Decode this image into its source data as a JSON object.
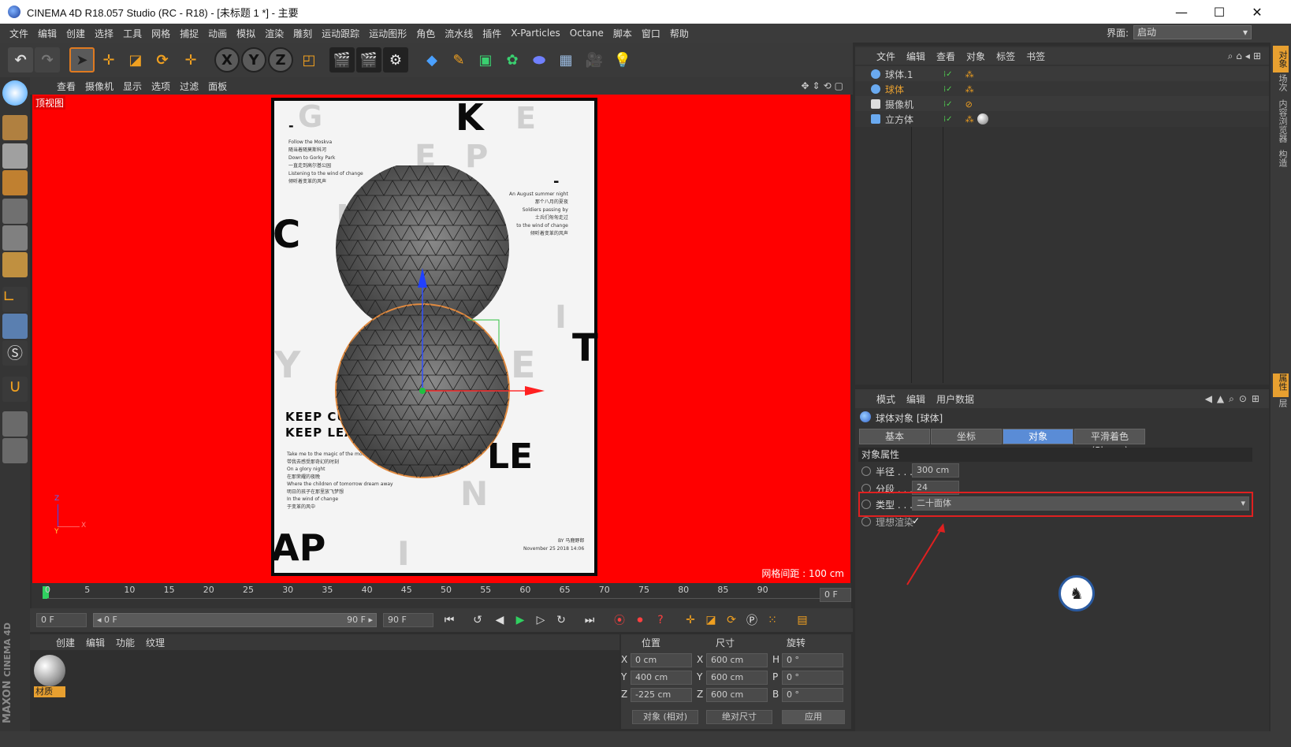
{
  "window": {
    "title": "CINEMA 4D R18.057 Studio (RC - R18) - [未标题 1 *] - 主要",
    "min": "—",
    "max": "☐",
    "close": "✕"
  },
  "menu": [
    "文件",
    "编辑",
    "创建",
    "选择",
    "工具",
    "网格",
    "捕捉",
    "动画",
    "模拟",
    "渲染",
    "雕刻",
    "运动跟踪",
    "运动图形",
    "角色",
    "流水线",
    "插件",
    "X-Particles",
    "Octane",
    "脚本",
    "窗口",
    "帮助"
  ],
  "layout": {
    "label": "界面:",
    "value": "启动"
  },
  "toolbar": {
    "x": "X",
    "y": "Y",
    "z": "Z"
  },
  "viewport": {
    "menu": [
      "查看",
      "摄像机",
      "显示",
      "选项",
      "过滤",
      "面板"
    ],
    "view_name": "顶视图",
    "grid_spacing": "网格间距 : 100 cm",
    "axis_y": "Y",
    "axis_z": "Z",
    "axis_x": "X"
  },
  "poster": {
    "big": {
      "g1": "G",
      "k": "K",
      "e1": "E",
      "e2": "E",
      "p": "P",
      "c": "C",
      "u": "U",
      "i1": "I",
      "t": "T",
      "y": "Y",
      "e3": "E",
      "le": "LE",
      "n": "N",
      "ap": "AP",
      "i2": "I",
      "dash1": "-",
      "dash2": "-"
    },
    "left_text": [
      "Follow the Moskva",
      "随当着随莫斯科河",
      "Down to Gorky Park",
      "一直走到高尔基公园",
      "Listening to the wind of change",
      "倾听着变革的风声"
    ],
    "right_text": [
      "An August summer night",
      "那个八月的夏夜",
      "Soldiers passing by",
      "士兵们匆匆走过",
      "to the wind of change",
      "倾听着变革的风声"
    ],
    "headline1": "KEEP CUR",
    "headline2": "KEEP LEAR",
    "lower_text": [
      "Take me to the magic of the moment",
      "带我去感受那奇幻的时刻",
      "On a glory night",
      "在那荣耀的夜晚",
      "Where the children of tomorrow dream away",
      "明日的孩子在那里放飞梦想",
      "In the wind of change",
      "于变革的风中"
    ],
    "by": "BY 马鹿野郎",
    "date": "November 25 2018 14:06"
  },
  "timeline": {
    "ticks": [
      "0",
      "5",
      "10",
      "15",
      "20",
      "25",
      "30",
      "35",
      "40",
      "45",
      "50",
      "55",
      "60",
      "65",
      "70",
      "75",
      "80",
      "85",
      "90"
    ],
    "end_field": "0 F"
  },
  "transport": {
    "current": "0 F",
    "range_start": "◂ 0 F",
    "range_end": "90 F ▸",
    "max": "90 F"
  },
  "materials": {
    "menu": [
      "创建",
      "编辑",
      "功能",
      "纹理"
    ],
    "item": "材质"
  },
  "coords": {
    "headers": [
      "位置",
      "尺寸",
      "旋转"
    ],
    "rows": [
      {
        "axis": "X",
        "pos": "0 cm",
        "saxis": "X",
        "size": "600 cm",
        "raxis": "H",
        "rot": "0 °"
      },
      {
        "axis": "Y",
        "pos": "400 cm",
        "saxis": "Y",
        "size": "600 cm",
        "raxis": "P",
        "rot": "0 °"
      },
      {
        "axis": "Z",
        "pos": "-225 cm",
        "saxis": "Z",
        "size": "600 cm",
        "raxis": "B",
        "rot": "0 °"
      }
    ],
    "mode": "对象 (相对)",
    "size_mode": "绝对尺寸",
    "apply": "应用"
  },
  "objects": {
    "menu": [
      "文件",
      "编辑",
      "查看",
      "对象",
      "标签",
      "书签"
    ],
    "items": [
      {
        "name": "球体.1",
        "highlight": false
      },
      {
        "name": "球体",
        "highlight": true
      },
      {
        "name": "摄像机",
        "highlight": false
      },
      {
        "name": "立方体",
        "highlight": false
      }
    ]
  },
  "attributes": {
    "menu": [
      "模式",
      "编辑",
      "用户数据"
    ],
    "title": "球体对象 [球体]",
    "tabs": [
      "基本",
      "坐标",
      "对象",
      "平滑着色(Phong)"
    ],
    "section": "对象属性",
    "radius_label": "半径 . . .",
    "radius": "300 cm",
    "segments_label": "分段 . . .",
    "segments": "24",
    "type_label": "类型 . . .",
    "type": "二十面体",
    "render_label": "理想渲染",
    "render_check": "✓"
  },
  "right_strip": [
    "对象",
    "场次",
    "内容浏览器",
    "构造",
    "属性",
    "层"
  ],
  "maxon": {
    "line1": "MAXON",
    "line2": "CINEMA 4D"
  },
  "colors": {
    "accent_blue": "#5a8cd6",
    "highlight": "#e8a030",
    "viewport_bg": "#ff0000",
    "annotation": "#e02020"
  }
}
